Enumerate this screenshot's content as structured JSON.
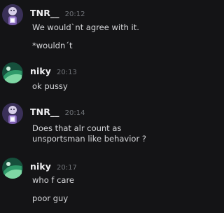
{
  "messages": [
    {
      "author": "TNR__",
      "time": "20:12",
      "avatar_icon": "tnr-avatar-icon",
      "lines": [
        "We would`nt agree with it.",
        "*wouldn´t"
      ]
    },
    {
      "author": "niky",
      "time": "20:13",
      "avatar_icon": "niky-avatar-icon",
      "lines": [
        "ok pussy"
      ]
    },
    {
      "author": "TNR__",
      "time": "20:14",
      "avatar_icon": "tnr-avatar-icon",
      "lines": [
        "Does that alr count as",
        "unsportsman like behavior ?"
      ]
    },
    {
      "author": "niky",
      "time": "20:17",
      "avatar_icon": "niky-avatar-icon",
      "lines": [
        "who f care",
        "poor guy"
      ]
    }
  ],
  "colors": {
    "background": "#141416",
    "username": "#f0f0f2",
    "timestamp": "#6f7277",
    "text": "#d6d7da"
  }
}
